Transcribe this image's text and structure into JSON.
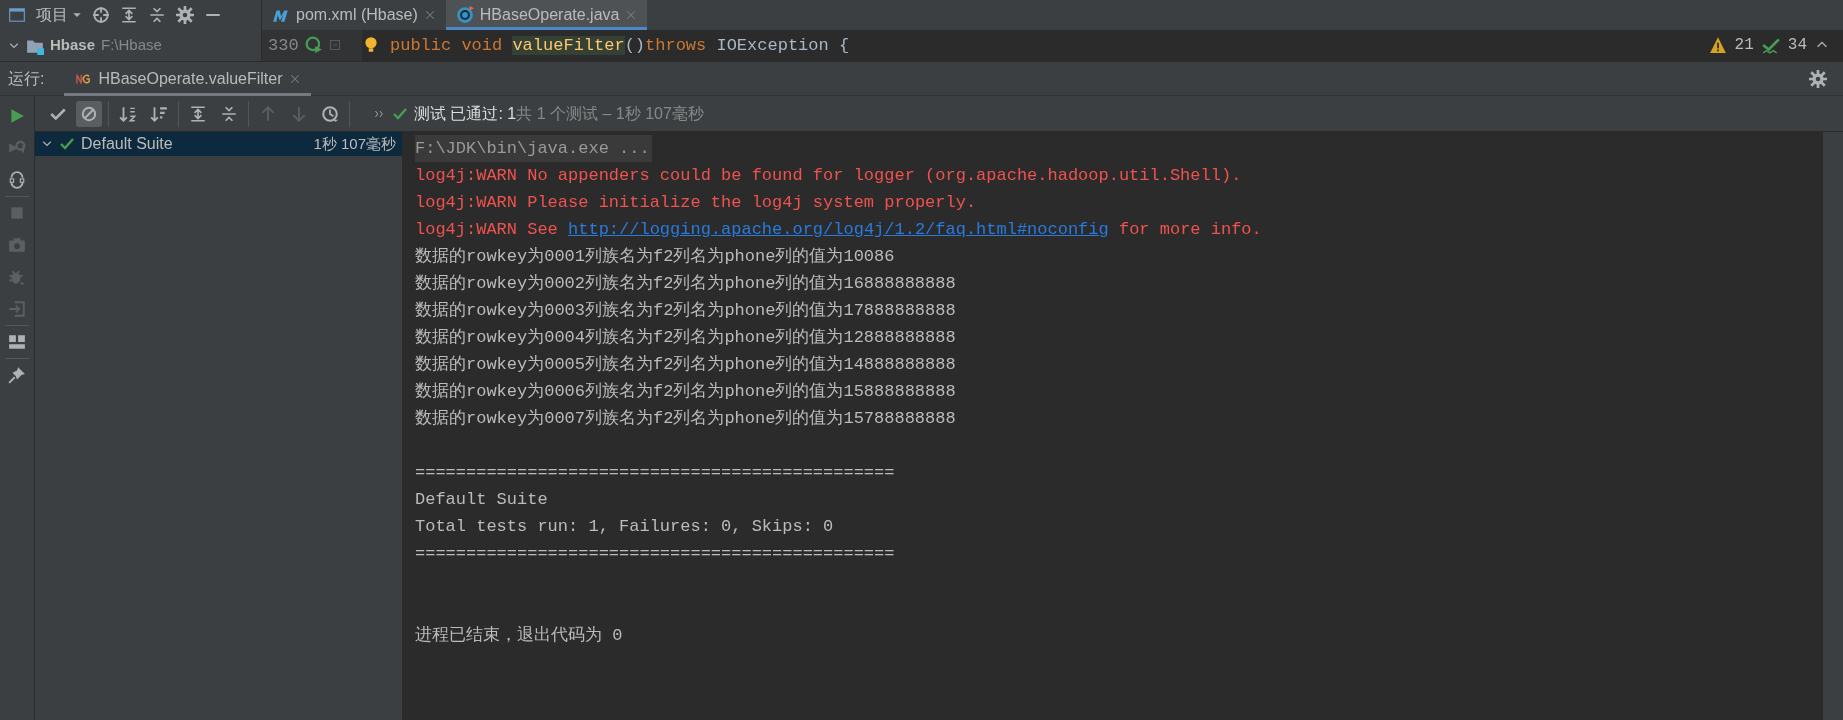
{
  "project_panel": {
    "view_label": "项目",
    "tree": [
      {
        "name": "Hbase",
        "path": "F:\\Hbase",
        "expanded": true
      }
    ]
  },
  "editor_tabs": [
    {
      "label": "pom.xml (Hbase)",
      "kind": "maven",
      "selected": false
    },
    {
      "label": "HBaseOperate.java",
      "kind": "java",
      "selected": true
    }
  ],
  "editor": {
    "line_number": "330",
    "code": [
      {
        "kind": "keyword",
        "text": "public void "
      },
      {
        "kind": "method",
        "text": "valueFilter"
      },
      {
        "kind": "plain",
        "text": "()"
      },
      {
        "kind": "keyword",
        "text": "throws "
      },
      {
        "kind": "plain",
        "text": "IOException {"
      }
    ],
    "warnings": "21",
    "weak_warnings": "34"
  },
  "run_panel": {
    "label": "运行:",
    "tabs": [
      {
        "label": "HBaseOperate.valueFilter",
        "selected": true
      }
    ]
  },
  "side_toolbar": [
    [
      {
        "kind": "run",
        "disabled": false
      },
      {
        "kind": "rerun-failed",
        "disabled": true
      },
      {
        "kind": "auto-test",
        "disabled": false
      }
    ],
    [
      {
        "kind": "stop",
        "disabled": true
      },
      {
        "kind": "camera",
        "disabled": true
      },
      {
        "kind": "debug",
        "disabled": true
      },
      {
        "kind": "exit",
        "disabled": true
      }
    ],
    [
      {
        "kind": "layout",
        "disabled": false
      }
    ],
    [
      {
        "kind": "pin",
        "disabled": false
      }
    ]
  ],
  "test_toolbar": [
    [
      {
        "kind": "show-passed",
        "disabled": false
      },
      {
        "kind": "show-ignored",
        "on": true,
        "disabled": false
      }
    ],
    [
      {
        "kind": "sort-alpha",
        "disabled": false
      },
      {
        "kind": "sort-duration",
        "disabled": false
      }
    ],
    [
      {
        "kind": "expand-all",
        "disabled": false
      },
      {
        "kind": "collapse-all",
        "disabled": false
      }
    ],
    [
      {
        "kind": "previous",
        "disabled": true
      },
      {
        "kind": "next",
        "disabled": true
      },
      {
        "kind": "history",
        "disabled": false
      }
    ]
  ],
  "test_status": {
    "label": "测试 已通过: ",
    "passed": "1",
    "detail": "共 1 个测试 – 1秒 107毫秒"
  },
  "test_tree": [
    {
      "label": "Default Suite",
      "time": "1秒 107毫秒",
      "passed": true,
      "expanded": true,
      "selected": true
    }
  ],
  "console": [
    {
      "kind": "output",
      "lines": [
        {
          "kind": "command",
          "text": "F:\\JDK\\bin\\java.exe ..."
        },
        {
          "kind": "warn",
          "text": "log4j:WARN No appenders could be found for logger (org.apache.hadoop.util.Shell)."
        },
        {
          "kind": "warn",
          "text": "log4j:WARN Please initialize the log4j system properly."
        },
        {
          "kind": "warn",
          "text": "log4j:WARN See ",
          "link": "http://logging.apache.org/log4j/1.2/faq.html#noconfig",
          "after": " for more info."
        },
        {
          "kind": "out",
          "text": "数据的rowkey为0001列族名为f2列名为phone列的值为10086"
        },
        {
          "kind": "out",
          "text": "数据的rowkey为0002列族名为f2列名为phone列的值为16888888888"
        },
        {
          "kind": "out",
          "text": "数据的rowkey为0003列族名为f2列名为phone列的值为17888888888"
        },
        {
          "kind": "out",
          "text": "数据的rowkey为0004列族名为f2列名为phone列的值为12888888888"
        },
        {
          "kind": "out",
          "text": "数据的rowkey为0005列族名为f2列名为phone列的值为14888888888"
        },
        {
          "kind": "out",
          "text": "数据的rowkey为0006列族名为f2列名为phone列的值为15888888888"
        },
        {
          "kind": "out",
          "text": "数据的rowkey为0007列族名为f2列名为phone列的值为15788888888"
        }
      ]
    },
    {
      "kind": "summary",
      "lines": [
        {
          "kind": "out",
          "text": "==============================================="
        },
        {
          "kind": "out",
          "text": "Default Suite"
        },
        {
          "kind": "out",
          "text": "Total tests run: 1, Failures: 0, Skips: 0"
        },
        {
          "kind": "out",
          "text": "==============================================="
        }
      ]
    },
    {
      "kind": "exit",
      "lines": [
        {
          "kind": "out",
          "text": "进程已结束，退出代码为 0"
        }
      ]
    }
  ]
}
